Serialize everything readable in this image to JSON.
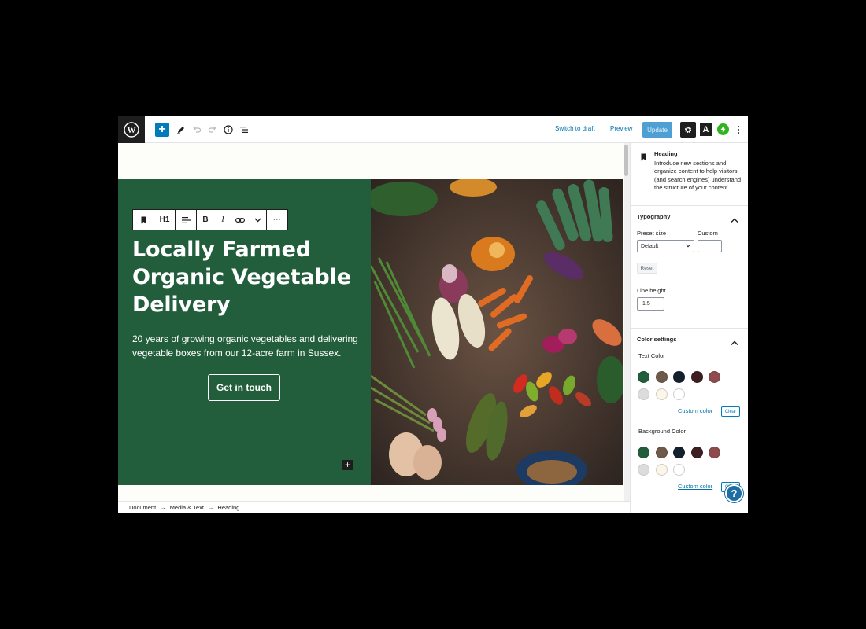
{
  "topbar": {
    "switch_to_draft": "Switch to draft",
    "preview": "Preview",
    "update": "Update",
    "a_label": "A",
    "add": "+"
  },
  "colors": {
    "accent": "#007cba",
    "green_panel": "#225e3b"
  },
  "block_toolbar": {
    "heading_level": "H1",
    "bold": "B",
    "italic": "I",
    "more": "···"
  },
  "content": {
    "heading": "Locally Farmed Organic Vegetable Delivery",
    "intro": "20 years of growing organic vegetables and delivering vegetable boxes from our 12-acre farm in Sussex.",
    "cta": "Get in touch"
  },
  "breadcrumb": [
    "Document",
    "Media & Text",
    "Heading"
  ],
  "sidebar": {
    "block_title": "Heading",
    "block_description": "Introduce new sections and organize content to help visitors (and search engines) understand the structure of your content.",
    "typography": {
      "title": "Typography",
      "preset_label": "Preset size",
      "preset_value": "Default",
      "custom_label": "Custom",
      "reset": "Reset",
      "line_height_label": "Line height",
      "line_height_value": "1.5"
    },
    "color_settings": {
      "title": "Color settings",
      "text_color_label": "Text Color",
      "background_color_label": "Background Color",
      "custom_color": "Custom color",
      "clear": "Clear",
      "palette": [
        "#225e3b",
        "#6d5a4a",
        "#15202e",
        "#3e1f21",
        "#8e4a4d",
        "#dcdcdc",
        "#fcf6e6",
        "#ffffff"
      ]
    }
  },
  "help": "?"
}
